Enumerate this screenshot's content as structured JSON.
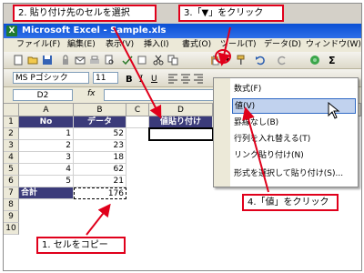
{
  "callouts": {
    "step1": "1. セルをコピー",
    "step2": "2. 貼り付け先のセルを選択",
    "step3": "3.「▼」をクリック",
    "step4": "4.「値」をクリック"
  },
  "window": {
    "title": "Microsoft Excel - Sample.xls",
    "app_icon": "X"
  },
  "menubar": [
    "ファイル(F)",
    "編集(E)",
    "表示(V)",
    "挿入(I)",
    "書式(O)",
    "ツール(T)",
    "データ(D)",
    "ウィンドウ(W)"
  ],
  "font_toolbar": {
    "font": "MS Pゴシック",
    "size": "11"
  },
  "formula_bar": {
    "name_box": "D2",
    "fx": "fx"
  },
  "sheet": {
    "columns": [
      "A",
      "B",
      "C",
      "D"
    ],
    "rows": [
      "1",
      "2",
      "3",
      "4",
      "5",
      "6",
      "7",
      "8",
      "9",
      "10"
    ],
    "header": {
      "a": "No",
      "b": "データ",
      "d": "値貼り付け"
    },
    "data": [
      {
        "a": "1",
        "b": "52"
      },
      {
        "a": "2",
        "b": "23"
      },
      {
        "a": "3",
        "b": "18"
      },
      {
        "a": "4",
        "b": "62"
      },
      {
        "a": "5",
        "b": "21"
      }
    ],
    "total": {
      "a": "合計",
      "b": "176"
    }
  },
  "paste_menu": {
    "items": [
      "数式(F)",
      "値(V)",
      "罫線なし(B)",
      "行列を入れ替える(T)",
      "リンク貼り付け(N)",
      "形式を選択して貼り付け(S)..."
    ],
    "selected_index": 1
  },
  "colors": {
    "header_bg": "#3b3b7a",
    "accent_red": "#e0001b",
    "title_blue": "#0a4fd4",
    "menu_highlight": "#c1d2ee"
  }
}
